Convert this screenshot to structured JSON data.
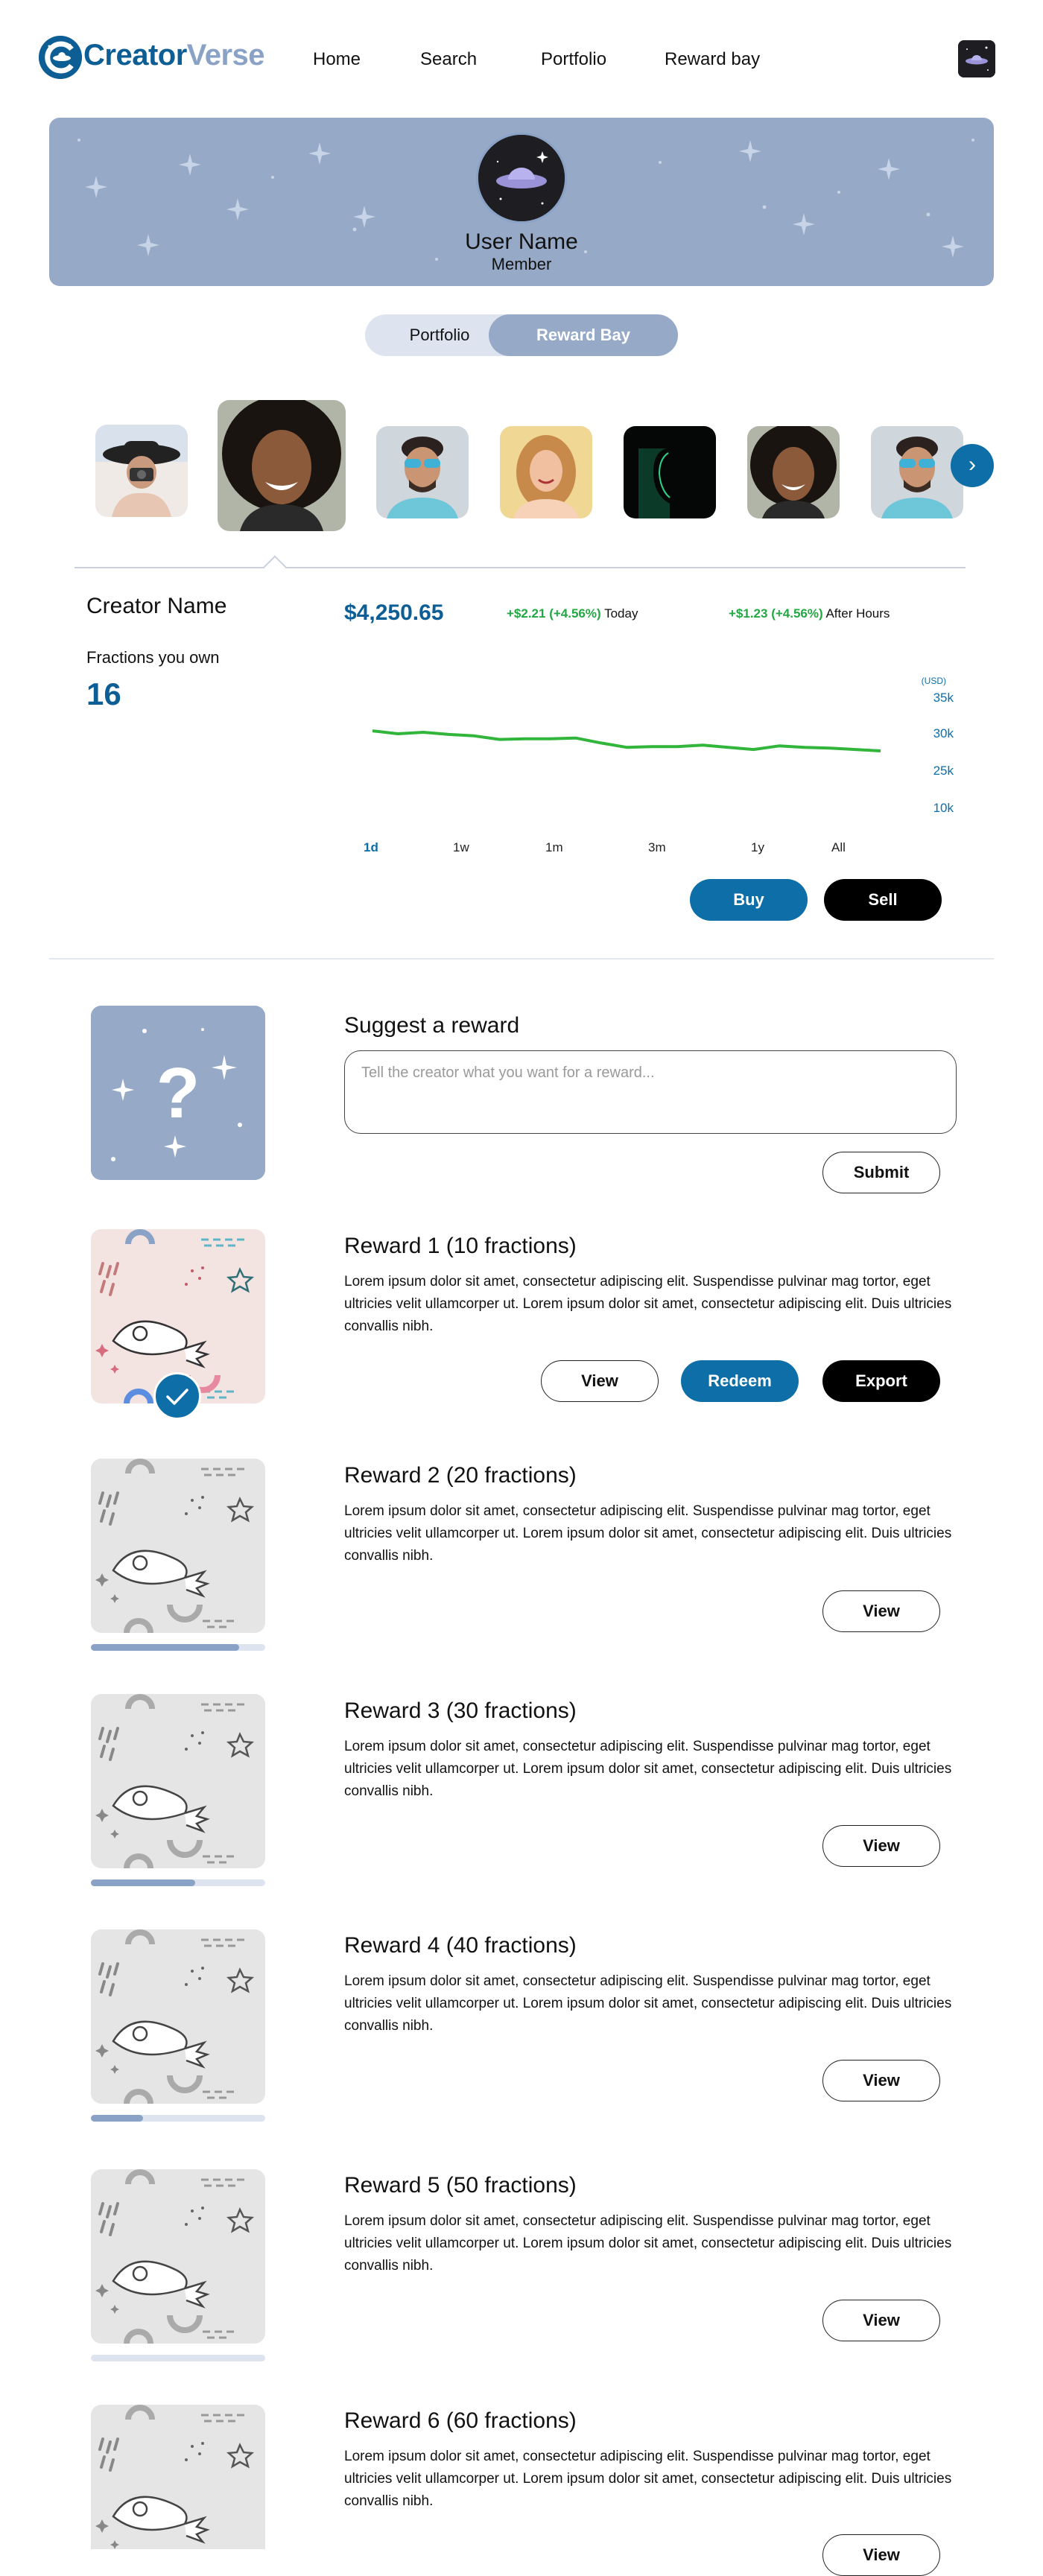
{
  "brand": {
    "name_part1": "Creator",
    "name_part2": "Verse"
  },
  "nav": {
    "home": "Home",
    "search": "Search",
    "portfolio": "Portfolio",
    "reward_bay": "Reward bay"
  },
  "profile": {
    "user_name": "User Name",
    "role": "Member"
  },
  "toggle": {
    "portfolio": "Portfolio",
    "reward_bay": "Reward Bay",
    "active": "Reward Bay"
  },
  "creators": {
    "next_icon": "chevron-right-icon",
    "selected_index": 1,
    "items": [
      {
        "icon": "creator-photo-woman-hat-camera"
      },
      {
        "icon": "creator-photo-woman-curly-hair"
      },
      {
        "icon": "creator-photo-man-sunglasses"
      },
      {
        "icon": "creator-photo-woman-blonde"
      },
      {
        "icon": "creator-photo-dark-silhouette"
      },
      {
        "icon": "creator-photo-woman-curly-hair"
      },
      {
        "icon": "creator-photo-man-sunglasses"
      }
    ]
  },
  "stats": {
    "creator_name": "Creator Name",
    "fractions_label": "Fractions you own",
    "fractions_value": "16",
    "price": "$4,250.65",
    "today_change": "+$2.21 (+4.56%)",
    "today_label": "Today",
    "after_change": "+$1.23 (+4.56%)",
    "after_label": "After Hours"
  },
  "chart_data": {
    "type": "line",
    "currency_label": "(USD)",
    "y_ticks": [
      "35k",
      "30k",
      "25k",
      "10k"
    ],
    "series": [
      {
        "values": [
          30.3,
          29.9,
          30.1,
          29.8,
          29.6,
          29.1,
          29.2,
          29.2,
          29.3,
          28.6,
          28.0,
          28.1,
          28.1,
          28.3,
          28.0,
          27.7,
          28.2,
          28.0,
          27.9,
          27.7,
          27.5
        ]
      }
    ],
    "color": "#31b53a",
    "ranges": [
      "1d",
      "1w",
      "1m",
      "3m",
      "1y",
      "All"
    ],
    "active_range": "1d"
  },
  "actions": {
    "buy": "Buy",
    "sell": "Sell"
  },
  "suggest": {
    "title": "Suggest a reward",
    "placeholder": "Tell the creator what you want for a reward...",
    "submit": "Submit",
    "card_icon": "question-mark-sparkles-icon"
  },
  "rewards": [
    {
      "title": "Reward 1 (10 fractions)",
      "desc": "Lorem ipsum dolor sit amet, consectetur adipiscing elit. Suspendisse pulvinar mag tortor, eget ultricies velit ullamcorper ut. Lorem ipsum dolor sit amet, consectetur adipiscing elit. Duis ultricies convallis nibh.",
      "view": "View",
      "redeem": "Redeem",
      "export": "Export",
      "unlocked": true
    },
    {
      "title": "Reward 2 (20 fractions)",
      "desc": "Lorem ipsum dolor sit amet, consectetur adipiscing elit. Suspendisse pulvinar mag tortor, eget ultricies velit ullamcorper ut. Lorem ipsum dolor sit amet, consectetur adipiscing elit. Duis ultricies convallis nibh.",
      "view": "View",
      "progress": 0.85
    },
    {
      "title": "Reward 3 (30 fractions)",
      "desc": "Lorem ipsum dolor sit amet, consectetur adipiscing elit. Suspendisse pulvinar mag tortor, eget ultricies velit ullamcorper ut. Lorem ipsum dolor sit amet, consectetur adipiscing elit. Duis ultricies convallis nibh.",
      "view": "View",
      "progress": 0.6
    },
    {
      "title": "Reward 4 (40 fractions)",
      "desc": "Lorem ipsum dolor sit amet, consectetur adipiscing elit. Suspendisse pulvinar mag tortor, eget ultricies velit ullamcorper ut. Lorem ipsum dolor sit amet, consectetur adipiscing elit. Duis ultricies convallis nibh.",
      "view": "View",
      "progress": 0.3
    },
    {
      "title": "Reward 5 (50 fractions)",
      "desc": "Lorem ipsum dolor sit amet, consectetur adipiscing elit. Suspendisse pulvinar mag tortor, eget ultricies velit ullamcorper ut. Lorem ipsum dolor sit amet, consectetur adipiscing elit. Duis ultricies convallis nibh.",
      "view": "View",
      "progress": 0.0
    },
    {
      "title": "Reward 6 (60 fractions)",
      "desc": "Lorem ipsum dolor sit amet, consectetur adipiscing elit. Suspendisse pulvinar mag tortor, eget ultricies velit ullamcorper ut. Lorem ipsum dolor sit amet, consectetur adipiscing elit. Duis ultricies convallis nibh.",
      "view": "View"
    }
  ],
  "colors": {
    "brand_blue": "#0e5e96",
    "accent_blue": "#0e6ea8",
    "slate": "#96a9c7",
    "green": "#22a843"
  }
}
